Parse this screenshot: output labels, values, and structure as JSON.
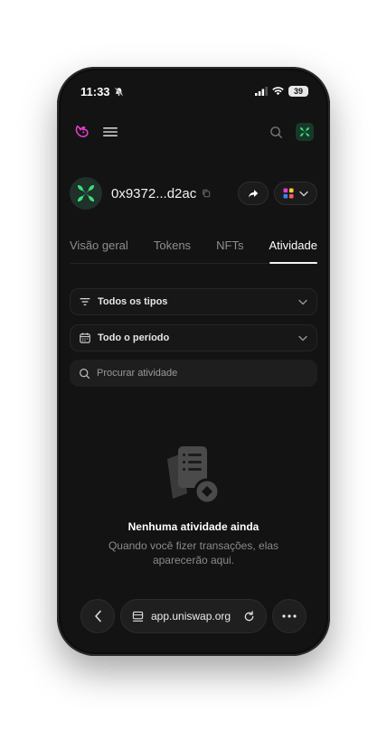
{
  "status_bar": {
    "time": "11:33",
    "battery": "39"
  },
  "account": {
    "address": "0x9372...d2ac"
  },
  "tabs": [
    {
      "label": "Visão geral",
      "active": false
    },
    {
      "label": "Tokens",
      "active": false
    },
    {
      "label": "NFTs",
      "active": false
    },
    {
      "label": "Atividade",
      "active": true
    }
  ],
  "filters": {
    "type_label": "Todos os tipos",
    "period_label": "Todo o período"
  },
  "search": {
    "placeholder": "Procurar atividade"
  },
  "empty_state": {
    "title": "Nenhuma atividade ainda",
    "subtitle": "Quando você fizer transações, elas aparecerão aqui."
  },
  "browser": {
    "url": "app.uniswap.org"
  },
  "colors": {
    "background": "#131313",
    "accent_pink": "#e63fd1",
    "accent_green": "#37e27c"
  }
}
